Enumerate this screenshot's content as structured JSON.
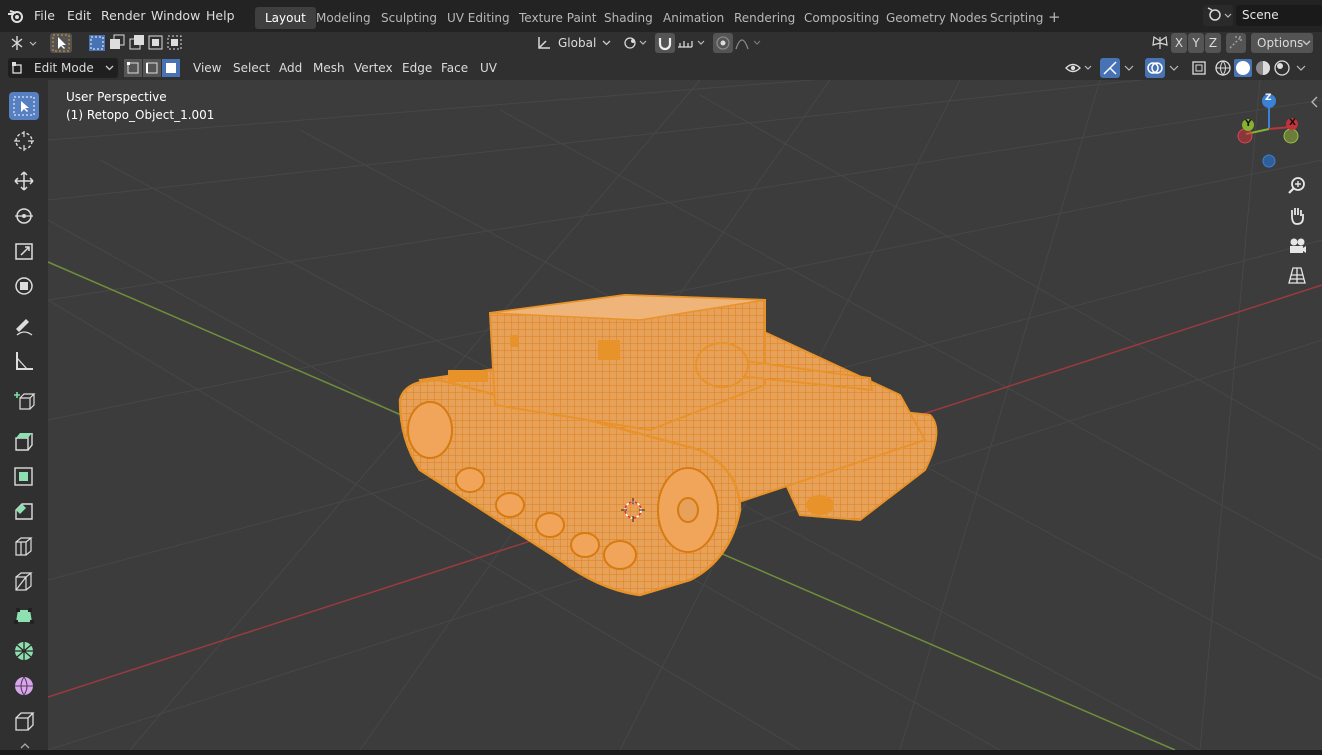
{
  "menubar": {
    "items": [
      "File",
      "Edit",
      "Render",
      "Window",
      "Help"
    ]
  },
  "workspaces": {
    "tabs": [
      "Layout",
      "Modeling",
      "Sculpting",
      "UV Editing",
      "Texture Paint",
      "Shading",
      "Animation",
      "Rendering",
      "Compositing",
      "Geometry Nodes",
      "Scripting"
    ],
    "add_label": "+"
  },
  "scene": {
    "name": "Scene"
  },
  "tool_header": {
    "transform_orientation": "Global",
    "axis_x": "X",
    "axis_y": "Y",
    "axis_z": "Z",
    "options_label": "Options"
  },
  "viewport_header": {
    "mode": "Edit Mode",
    "menus": [
      "View",
      "Select",
      "Add",
      "Mesh",
      "Vertex",
      "Edge",
      "Face",
      "UV"
    ]
  },
  "viewport": {
    "view_name": "User Perspective",
    "object_name": "(1) Retopo_Object_1.001"
  },
  "gizmo": {
    "z": "Z",
    "y": "Y",
    "x": "X"
  },
  "colors": {
    "accent_blue": "#4772b3",
    "mesh_orange": "#e8932a",
    "axis_x": "#c2323c",
    "axis_y": "#86b230",
    "axis_z": "#3a82d6"
  }
}
